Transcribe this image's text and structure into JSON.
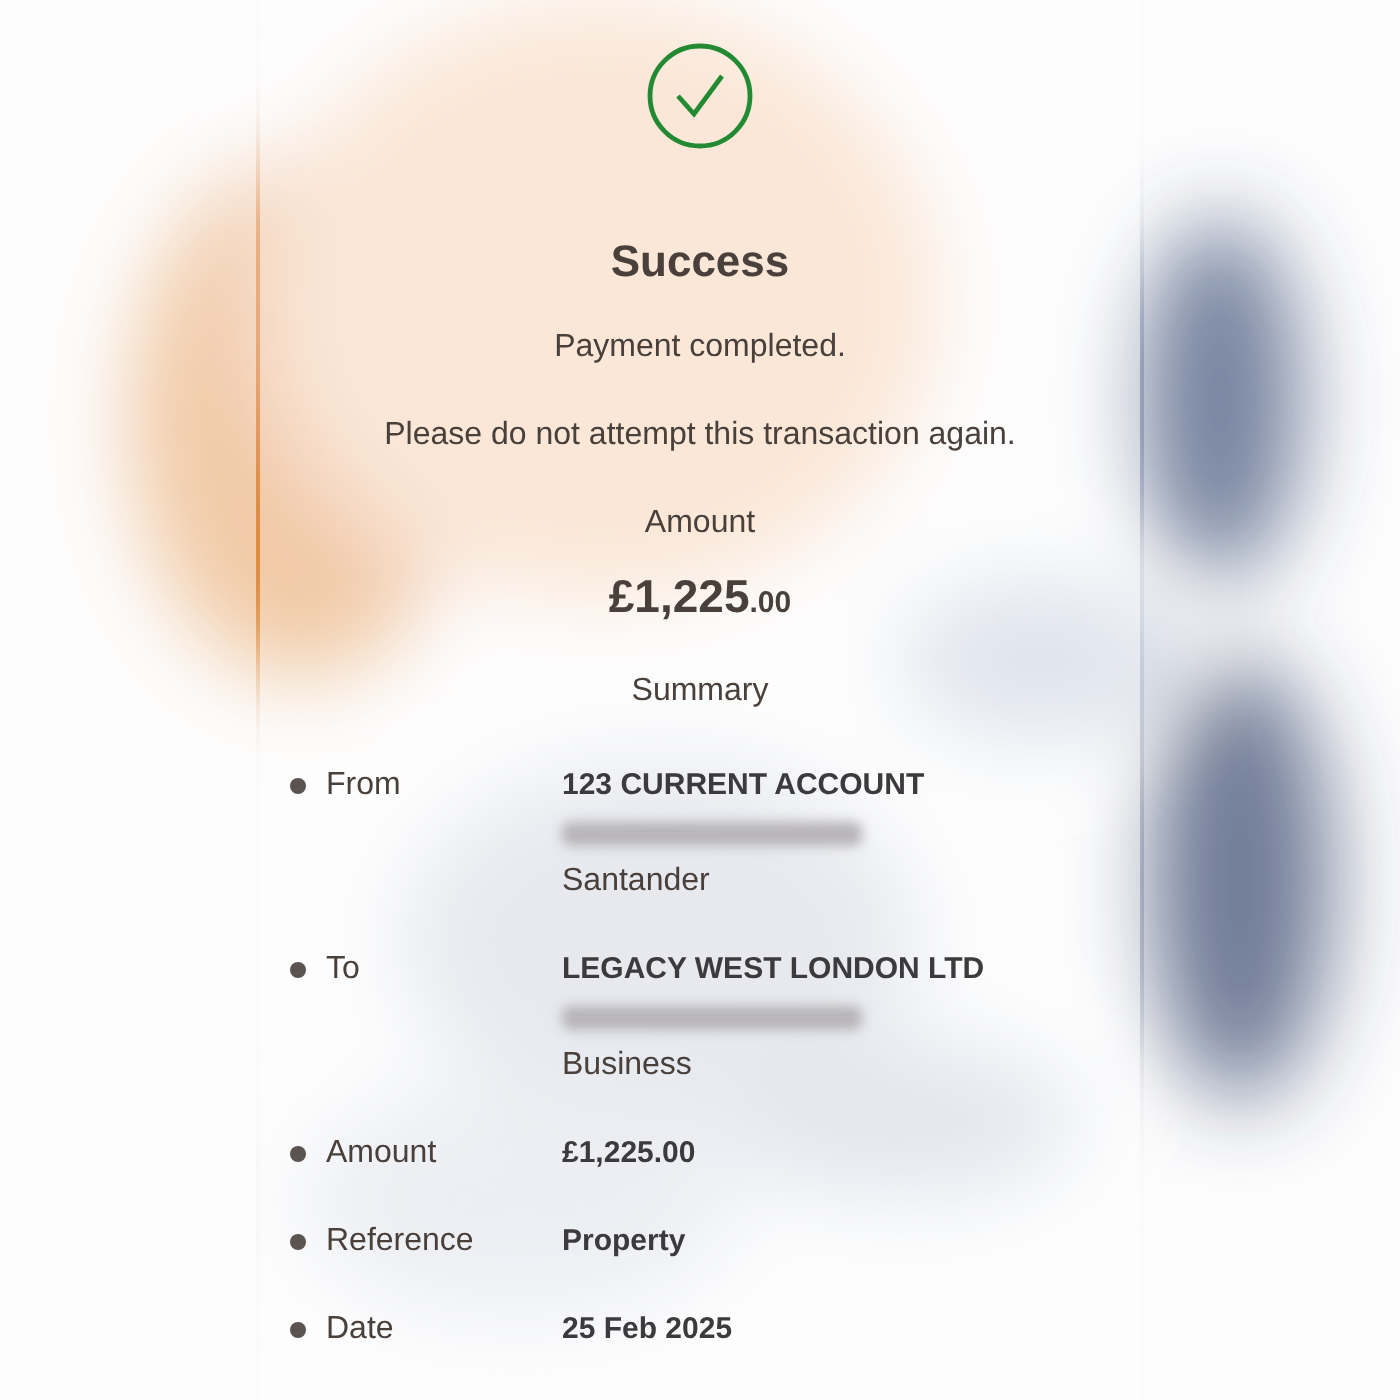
{
  "status": {
    "title": "Success",
    "messages": [
      "Payment completed.",
      "Please do not attempt this transaction again."
    ]
  },
  "amount": {
    "label": "Amount",
    "whole": "£1,225",
    "pence": ".00"
  },
  "summary": {
    "title": "Summary",
    "rows": [
      {
        "label": "From",
        "value": "123 CURRENT ACCOUNT",
        "masked_line": true,
        "note": "Santander"
      },
      {
        "label": "To",
        "value": "LEGACY WEST LONDON LTD",
        "masked_line": true,
        "note": "Business"
      },
      {
        "label": "Amount",
        "value": "£1,225.00"
      },
      {
        "label": "Reference",
        "value": "Property"
      },
      {
        "label": "Date",
        "value": "25 Feb 2025"
      }
    ]
  }
}
